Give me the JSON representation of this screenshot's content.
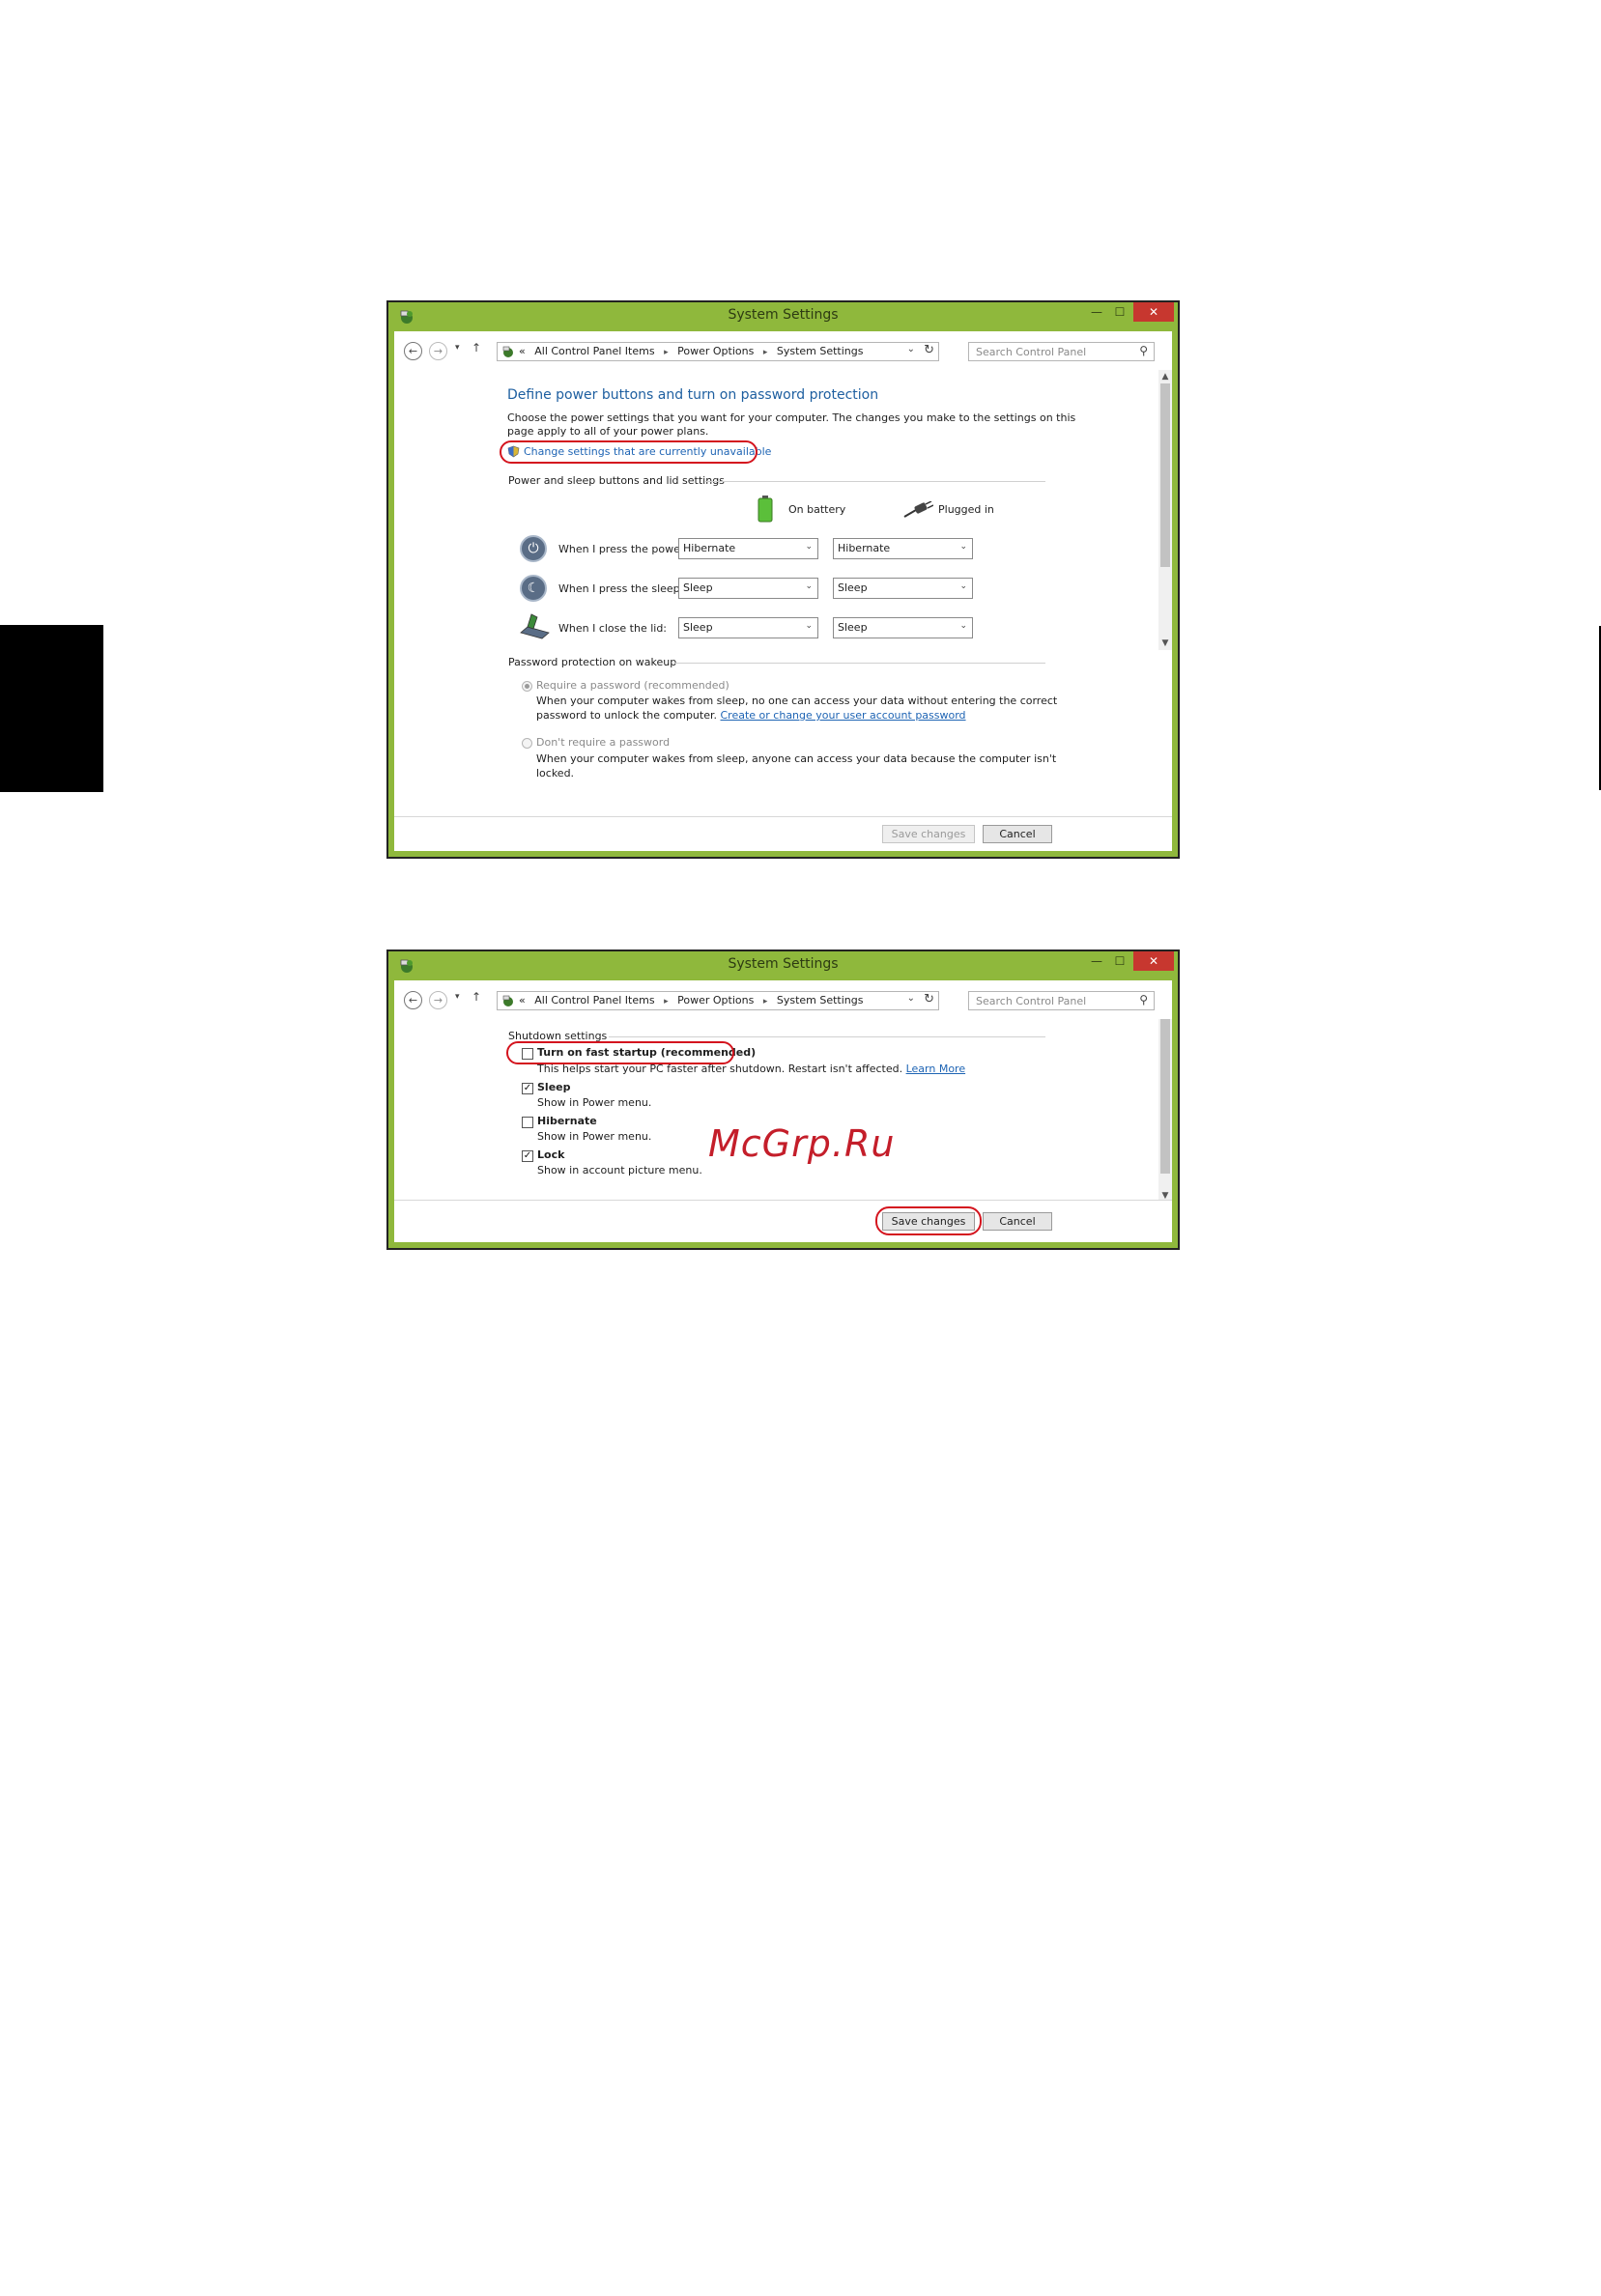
{
  "window1": {
    "title": "System Settings",
    "controls": {
      "minimize": "—",
      "maximize": "☐",
      "close": "✕"
    },
    "address": {
      "prefix": "«",
      "crumbs": [
        "All Control Panel Items",
        "Power Options",
        "System Settings"
      ]
    },
    "search_placeholder": "Search Control Panel",
    "heading": "Define power buttons and turn on password protection",
    "description_line1": "Choose the power settings that you want for your computer. The changes you make to the settings on this",
    "description_line2": "page apply to all of your power plans.",
    "change_settings_link": "Change settings that are currently unavailable",
    "power_group_label": "Power and sleep buttons and lid settings",
    "col_battery": "On battery",
    "col_plugged": "Plugged in",
    "rows": [
      {
        "label": "When I press the power button:",
        "battery": "Hibernate",
        "plugged": "Hibernate"
      },
      {
        "label": "When I press the sleep button:",
        "battery": "Sleep",
        "plugged": "Sleep"
      },
      {
        "label": "When I close the lid:",
        "battery": "Sleep",
        "plugged": "Sleep"
      }
    ],
    "password_group_label": "Password protection on wakeup",
    "require_label": "Require a password (recommended)",
    "require_desc1": "When your computer wakes from sleep, no one can access your data without entering the correct",
    "require_desc2_prefix": "password to unlock the computer.",
    "require_desc2_link": "Create or change your user account password",
    "dont_require_label": "Don't require a password",
    "dont_require_desc1": "When your computer wakes from sleep, anyone can access your data because the computer isn't",
    "dont_require_desc2": "locked.",
    "save_label": "Save changes",
    "cancel_label": "Cancel"
  },
  "window2": {
    "title": "System Settings",
    "controls": {
      "minimize": "—",
      "maximize": "☐",
      "close": "✕"
    },
    "address": {
      "prefix": "«",
      "crumbs": [
        "All Control Panel Items",
        "Power Options",
        "System Settings"
      ]
    },
    "search_placeholder": "Search Control Panel",
    "shutdown_group_label": "Shutdown settings",
    "options": [
      {
        "label": "Turn on fast startup (recommended)",
        "desc": "This helps start your PC faster after shutdown. Restart isn't affected.",
        "checked": false
      },
      {
        "label": "Sleep",
        "desc": "Show in Power menu.",
        "checked": true
      },
      {
        "label": "Hibernate",
        "desc": "Show in Power menu.",
        "checked": false
      },
      {
        "label": "Lock",
        "desc": "Show in account picture menu.",
        "checked": true
      }
    ],
    "learn_more": "Learn More",
    "save_label": "Save changes",
    "cancel_label": "Cancel"
  },
  "glyphs": {
    "back": "←",
    "forward": "→",
    "dropdown": "▾",
    "up": "↑",
    "sep": "▸",
    "chevron": "⌄",
    "refresh": "↻",
    "search": "⚲",
    "scroll_up": "▲",
    "scroll_down": "▼",
    "check": "✓",
    "power": "⏻",
    "sleep": "☾"
  },
  "watermark": "McGrp.Ru",
  "colors": {
    "window_frame": "#8fb83c",
    "close_button": "#c7372f",
    "heading": "#1e5fa0",
    "link": "#1e64b4",
    "highlight_oval": "#d4141e",
    "watermark": "#c41e2a"
  }
}
